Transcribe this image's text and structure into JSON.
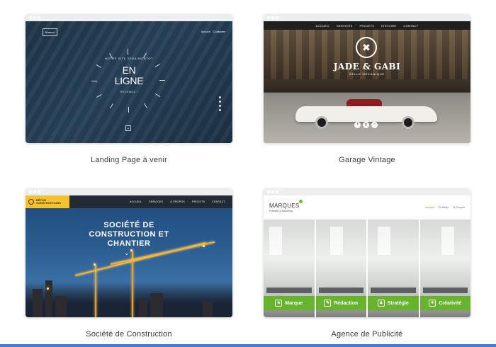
{
  "templates": [
    {
      "caption": "Landing Page à venir",
      "logo": "Maison",
      "nav": [
        "Accueil",
        "Contacter"
      ],
      "eyebrow": "NOTRE SITE SERA BIENTÔT",
      "headline_line1": "EN",
      "headline_line2": "LIGNE",
      "subline": "REVENEZ !",
      "icon": "chevron-down-icon"
    },
    {
      "caption": "Garage Vintage",
      "nav": [
        "ACCUEIL",
        "SERVICES",
        "PROJETS",
        "HISTOIRE",
        "CONTACT"
      ],
      "title": "JADE & GABI",
      "subtitle": "BELLE MÉCANIQUE",
      "icon": "wrench-icon",
      "social_icons": [
        "facebook-icon",
        "pinterest-icon",
        "instagram-icon"
      ]
    },
    {
      "caption": "Société de Construction",
      "brand_line1": "BÉTON",
      "brand_line2": "CONSTRUCTIONS",
      "nav": [
        "ACCUEIL",
        "SERVICES",
        "À PROPOS",
        "PROJETS",
        "CONTACT"
      ],
      "heading_line1": "SOCIÉTÉ DE",
      "heading_line2": "CONSTRUCTION ET",
      "heading_line3": "CHANTIER",
      "icon": "chevron-down-icon"
    },
    {
      "caption": "Agence de Publicité",
      "logo": "MARQUES",
      "logo_sub": "Publicité & Marketing",
      "nav": [
        "Accueil",
        "Portfolio",
        "À Propos"
      ],
      "panels": [
        {
          "label": "Marque",
          "icon": "badge-icon"
        },
        {
          "label": "Rédaction",
          "icon": "pen-icon"
        },
        {
          "label": "Stratégie",
          "icon": "chess-icon"
        },
        {
          "label": "Créativité",
          "icon": "lightbulb-icon"
        }
      ]
    }
  ],
  "colors": {
    "accent_blue": "#3d7fd1",
    "construction_yellow": "#f2c230",
    "agency_green": "#66b32e"
  }
}
